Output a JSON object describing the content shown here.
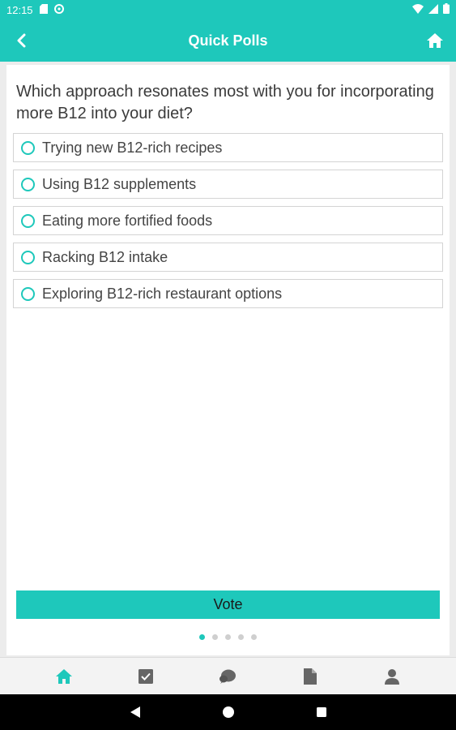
{
  "status_bar": {
    "time": "12:15"
  },
  "app_bar": {
    "title": "Quick Polls"
  },
  "poll": {
    "question": "Which approach resonates most with you for incorporating more B12 into your diet?",
    "options": [
      "Trying new B12-rich recipes",
      "Using B12 supplements",
      "Eating more fortified foods",
      "Racking B12 intake",
      "Exploring B12-rich restaurant options"
    ],
    "vote_label": "Vote",
    "pager": {
      "total": 5,
      "current": 1
    }
  },
  "bottom_nav": [
    "home-icon",
    "checkbox-icon",
    "chat-icon",
    "document-icon",
    "profile-icon"
  ],
  "colors": {
    "accent": "#1ec8bb",
    "border": "#d4d4d4",
    "text": "#3b3b3b"
  }
}
